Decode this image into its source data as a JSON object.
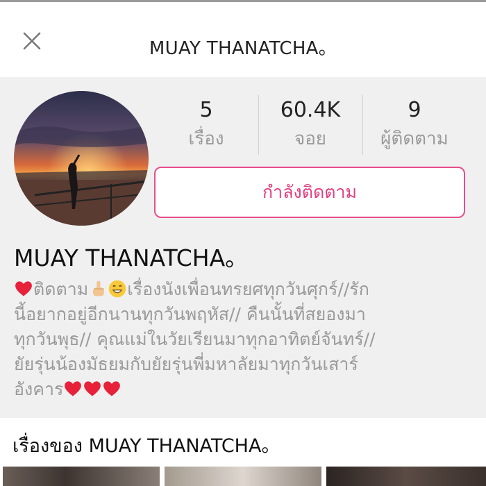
{
  "header": {
    "title": "MUAY THANATCHA。"
  },
  "stats": [
    {
      "value": "5",
      "label": "เรื่อง"
    },
    {
      "value": "60.4K",
      "label": "จอย"
    },
    {
      "value": "9",
      "label": "ผู้ติดตาม"
    }
  ],
  "follow_button": {
    "label": "กำลังติดตาม"
  },
  "profile": {
    "name": "MUAY THANATCHA。",
    "bio_lines": [
      {
        "a": "ติดตาม",
        "b": "เรื่องนังเพื่อนทรยศทุกวันศุกร์//รัก"
      },
      "นี้อยากอยู่อีกนานทุกวันพฤหัส// คืนนั้นที่สยองมา",
      "ทุกวันพุธ// คุณแม่ในวัยเรียนมาทุกอาทิตย์จันทร์//",
      "ยัยรุ่นน้องมัธยมกับยัยรุ่นพี่มหาลัยมาทุกวันเสาร์",
      "อังคาร"
    ]
  },
  "stories": {
    "title": "เรื่องของ MUAY THANATCHA。"
  },
  "colors": {
    "accent": "#e84d8c",
    "heart": "#e8213a",
    "muted": "#9a9a9a"
  },
  "icons": {
    "close": "close-icon",
    "heart": "heart-icon",
    "point": "pointing-hand-icon",
    "grin": "grinning-face-icon"
  }
}
